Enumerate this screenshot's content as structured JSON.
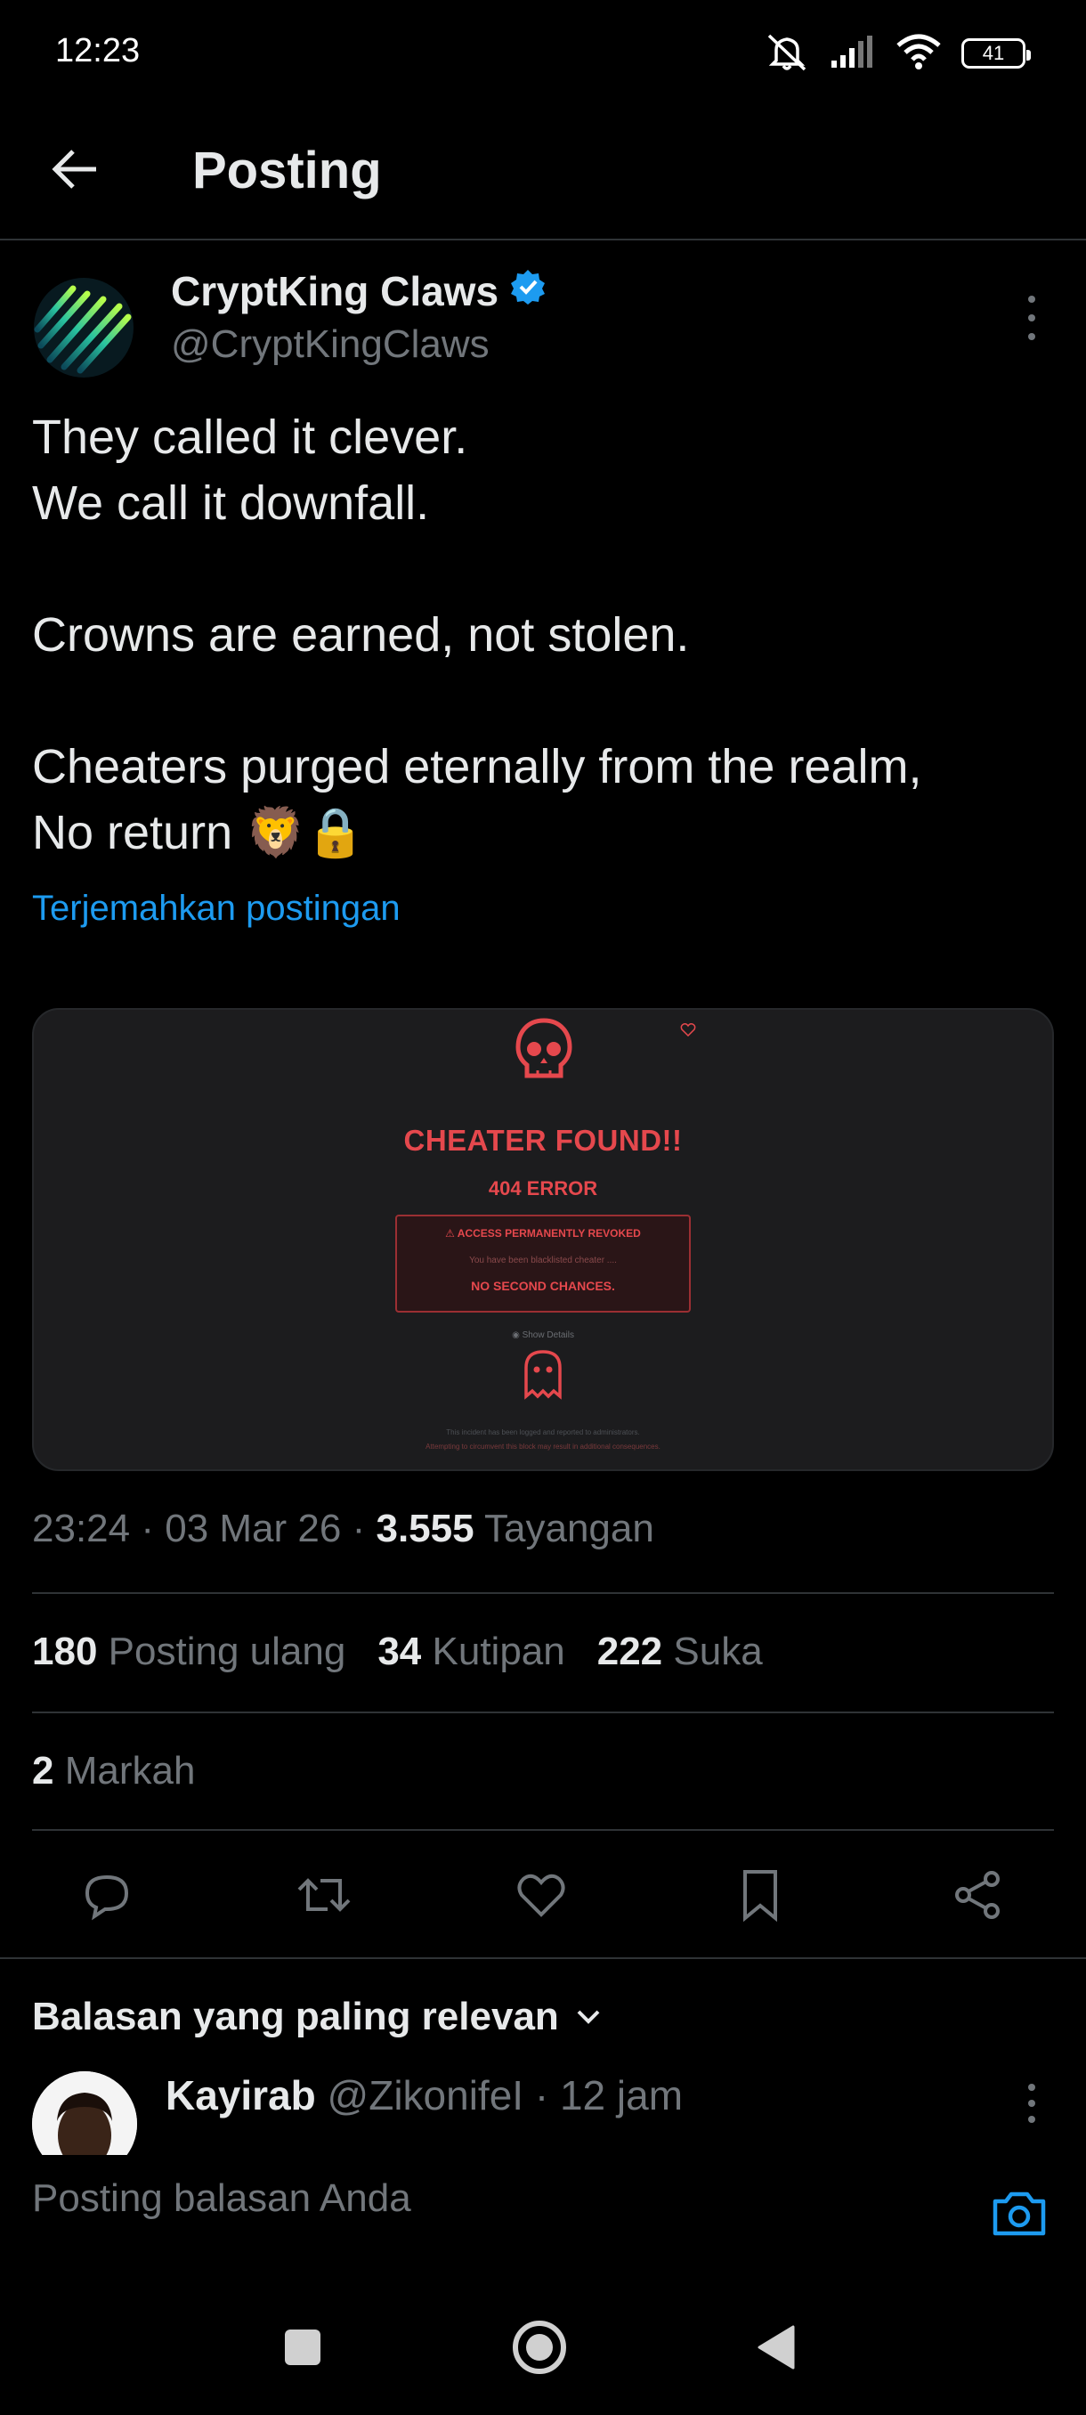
{
  "status_bar": {
    "time": "12:23",
    "battery": "41"
  },
  "header": {
    "title": "Posting"
  },
  "author": {
    "name": "CryptKing Claws",
    "handle": "@CryptKingClaws"
  },
  "post": {
    "lines": [
      "They called it clever.",
      "We call it downfall.",
      "",
      "Crowns are earned, not stolen.",
      "",
      "Cheaters purged eternally from the realm,",
      "No return 🦁🔒"
    ],
    "translate_label": "Terjemahkan postingan"
  },
  "media": {
    "title": "CHEATER FOUND!!",
    "code": "404 ERROR",
    "box_head": "ACCESS PERMANENTLY REVOKED",
    "box_sub": "You have been blacklisted cheater ....",
    "box_foot": "NO SECOND CHANCES.",
    "details": "Show Details",
    "note1": "This incident has been logged and reported to administrators.",
    "note2": "Attempting to circumvent this block may result in additional consequences."
  },
  "meta": {
    "time": "23:24",
    "date": "03 Mar 26",
    "views": "3.555",
    "views_label": "Tayangan"
  },
  "stats": {
    "reposts": "180",
    "reposts_label": "Posting ulang",
    "quotes": "34",
    "quotes_label": "Kutipan",
    "likes": "222",
    "likes_label": "Suka",
    "bookmarks": "2",
    "bookmarks_label": "Markah"
  },
  "icons": {
    "actions": [
      "reply-icon",
      "repost-icon",
      "like-icon",
      "bookmark-icon",
      "share-icon"
    ],
    "nav": [
      "recents-icon",
      "home-icon",
      "back-icon"
    ]
  },
  "replies": {
    "sort_label": "Balasan yang paling relevan"
  },
  "reply": {
    "name": "Kayirab",
    "handle": "@ZikonifeI",
    "age": "12 jam"
  },
  "compose": {
    "placeholder": "Posting balasan Anda"
  },
  "colors": {
    "accent": "#1d9bf0",
    "alert_red": "#e5484d",
    "muted": "#71767b",
    "divider": "#2f3336"
  }
}
